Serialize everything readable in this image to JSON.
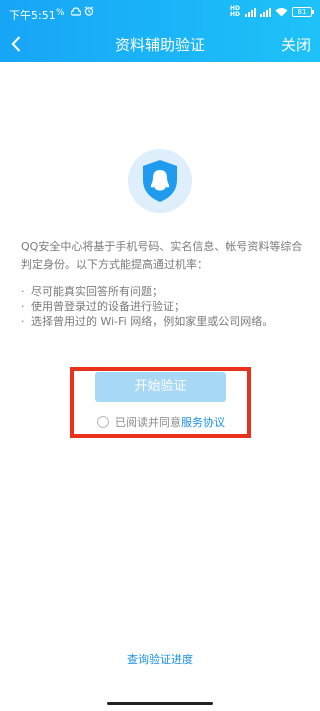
{
  "status_bar": {
    "time": "下午5:51",
    "battery": "81"
  },
  "nav": {
    "title": "资料辅助验证",
    "close_label": "关闭"
  },
  "main": {
    "description": "QQ安全中心将基于手机号码、实名信息、帐号资料等综合判定身份。以下方式能提高通过机率：",
    "tips": [
      "尽可能真实回答所有问题；",
      "使用曾登录过的设备进行验证；",
      "选择曾用过的 Wi-Fi 网络，例如家里或公司网络。"
    ],
    "start_button_label": "开始验证",
    "agreement_text": "已阅读并同意",
    "agreement_link": "服务协议",
    "progress_link": "查询验证进度"
  },
  "colors": {
    "header_start": "#17a5f6",
    "header_end": "#1ec2f9",
    "button_disabled": "#a7d9f7",
    "link": "#1a8fe6",
    "highlight": "#e8321c"
  }
}
